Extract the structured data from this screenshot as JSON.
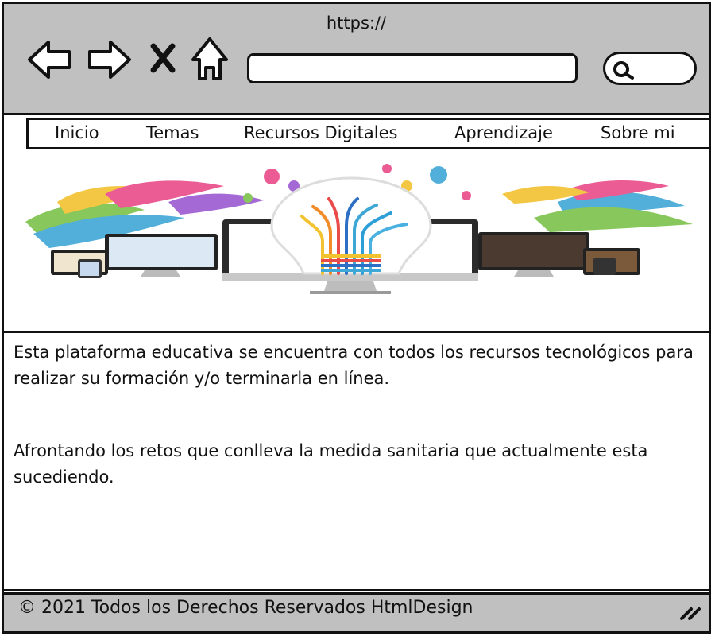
{
  "browser": {
    "url_label": "https://",
    "address_value": "",
    "icons": [
      "back-arrow-icon",
      "forward-arrow-icon",
      "close-x-icon",
      "home-icon",
      "search-icon"
    ]
  },
  "menu": {
    "items": [
      {
        "label": "Inicio"
      },
      {
        "label": "Temas"
      },
      {
        "label": "Recursos Digitales"
      },
      {
        "label": "Aprendizaje"
      },
      {
        "label": "Sobre mi"
      }
    ]
  },
  "content": {
    "paragraph_1": "Esta plataforma educativa se encuentra con todos los recursos tecnológicos para realizar su formación y/o terminarla en línea.",
    "paragraph_2": "Afrontando los retos que conlleva la medida sanitaria que actualmente esta sucediendo."
  },
  "footer": {
    "text": "© 2021 Todos los Derechos Reservados HtmlDesign"
  },
  "colors": {
    "chrome_gray": "#c0c0c0",
    "border": "#111111",
    "background": "#ffffff"
  }
}
